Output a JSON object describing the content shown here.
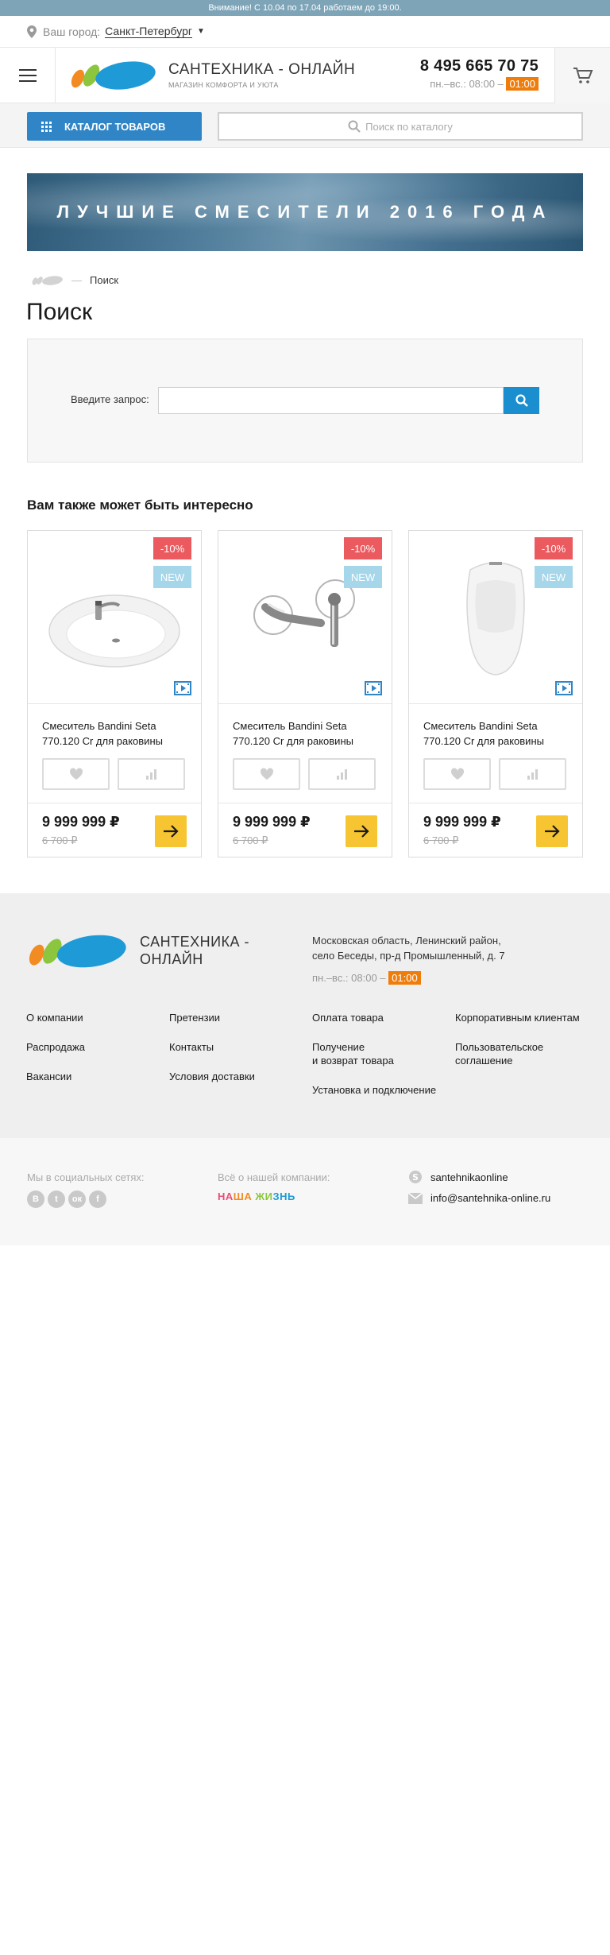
{
  "notice": "Внимание! С 10.04 по 17.04 работаем до 19:00.",
  "city": {
    "label": "Ваш город:",
    "value": "Санкт-Петербург"
  },
  "brand": {
    "title": "САНТЕХНИКА - ОНЛАЙН",
    "subtitle": "МАГАЗИН КОМФОРТА И УЮТА"
  },
  "contacts": {
    "phone": "8 495 665 70 75",
    "hours_prefix": "пн.–вс.: 08:00 –",
    "hours_end": "01:00"
  },
  "catalog_button": "КАТАЛОГ ТОВАРОВ",
  "top_search": {
    "placeholder": "Поиск по каталогу"
  },
  "banner": {
    "text": "ЛУЧШИЕ СМЕСИТЕЛИ 2016 ГОДА"
  },
  "breadcrumb": {
    "current": "Поиск"
  },
  "page_title": "Поиск",
  "search_form": {
    "label": "Введите запрос:",
    "value": ""
  },
  "section_title": "Вам также может быть интересно",
  "products": [
    {
      "name": "Смеситель Bandini Seta 770.120 Cr для раковины",
      "discount": "-10%",
      "badge": "NEW",
      "price": "9 999 999 ₽",
      "old_price": "6 700 ₽",
      "image": "washbasin"
    },
    {
      "name": "Смеситель Bandini Seta 770.120 Cr для раковины",
      "discount": "-10%",
      "badge": "NEW",
      "price": "9 999 999 ₽",
      "old_price": "6 700 ₽",
      "image": "wall-faucet"
    },
    {
      "name": "Смеситель Bandini Seta 770.120 Cr для раковины",
      "discount": "-10%",
      "badge": "NEW",
      "price": "9 999 999 ₽",
      "old_price": "6 700 ₽",
      "image": "urinal"
    }
  ],
  "footer": {
    "brand_line1": "САНТЕХНИКА -",
    "brand_line2": "ОНЛАЙН",
    "address_line1": "Московская область, Ленинский район,",
    "address_line2": "село Беседы, пр-д Промышленный, д. 7",
    "hours_prefix": "пн.–вс.: 08:00 –",
    "hours_end": "01:00",
    "col1": [
      "О компании",
      "Распродажа",
      "Вакансии"
    ],
    "col2": [
      "Претензии",
      "Контакты",
      "Условия доставки"
    ],
    "col3": [
      "Оплата товара",
      "Получение\nи возврат товара",
      "Установка и подключение"
    ],
    "col4": [
      "Корпоративным клиентам",
      "Пользовательское\nсоглашение"
    ]
  },
  "subfooter": {
    "social_label": "Мы в социальных сетях:",
    "social": [
      "В",
      "t",
      "ок",
      "f"
    ],
    "about_label": "Всё о нашей компании:",
    "about_logo": "НАША ЖИЗНЬ",
    "skype": "santehnikaonline",
    "email": "info@santehnika-online.ru"
  },
  "colors": {
    "accent_blue": "#2f85c6",
    "notice": "#7ea4b7",
    "sale": "#ea5a5e",
    "new": "#a6d6ea",
    "buy": "#f7c531",
    "hours_badge": "#f07d0a"
  }
}
